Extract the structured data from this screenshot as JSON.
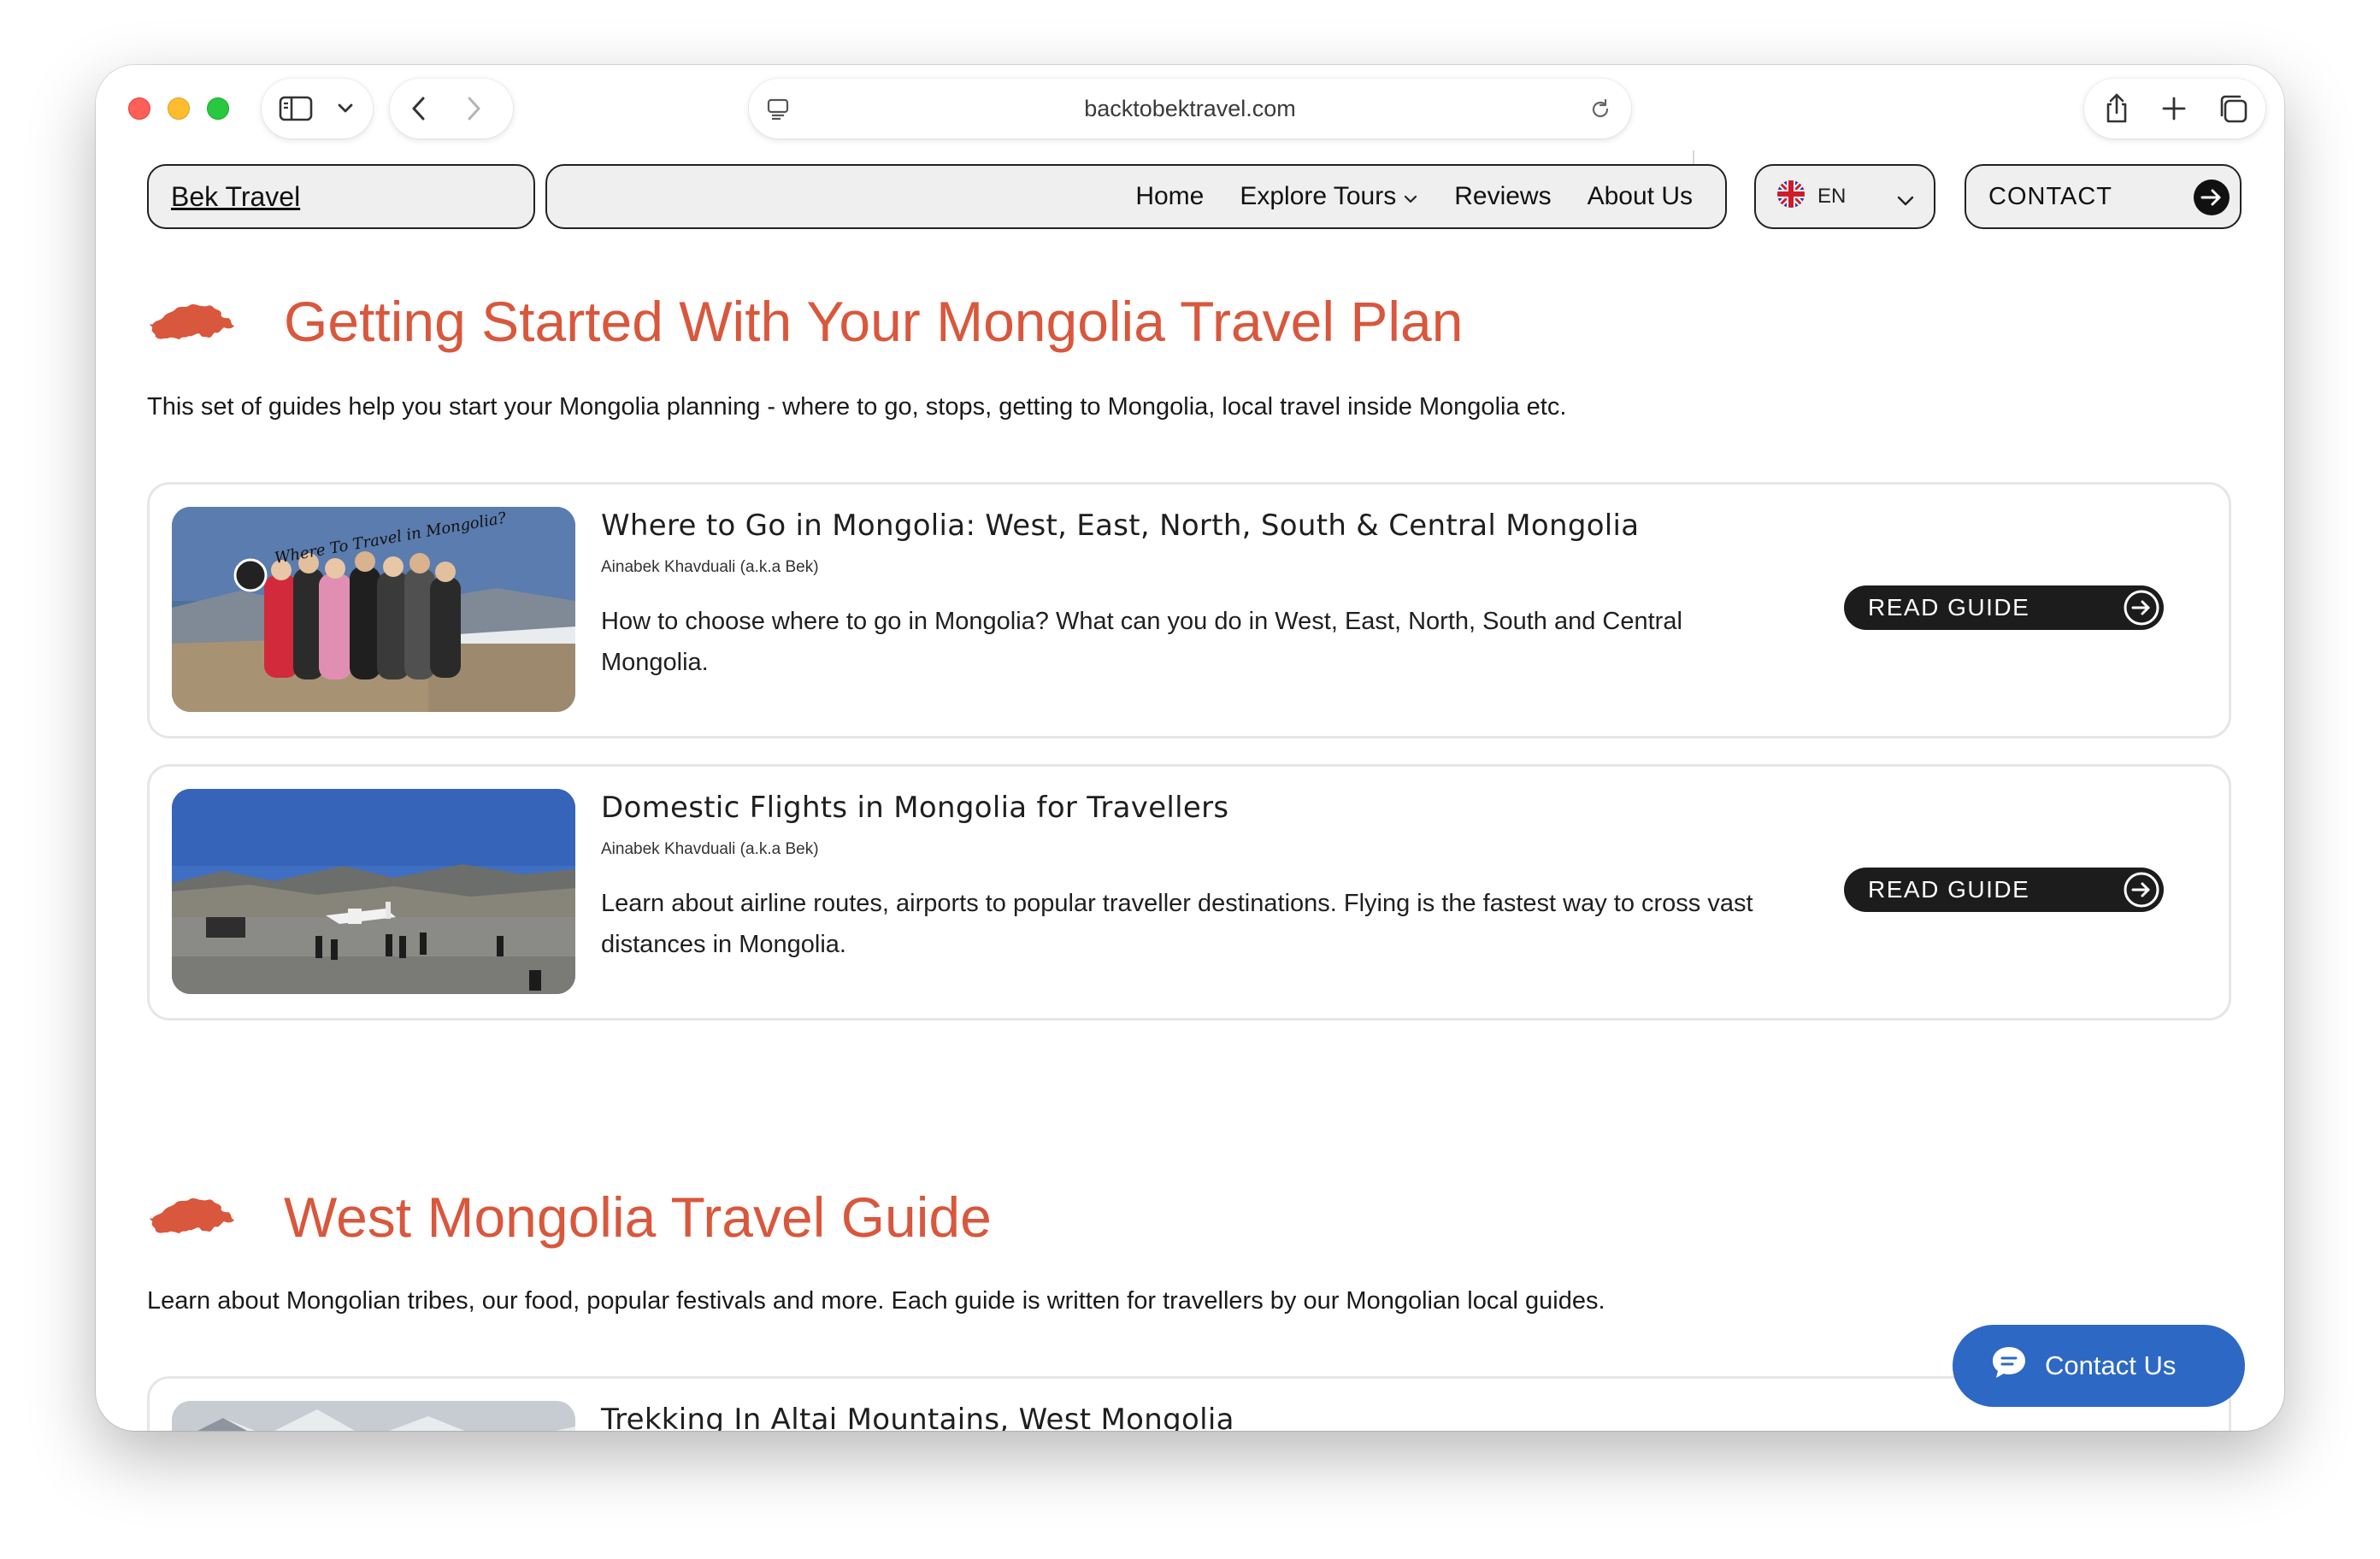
{
  "browser": {
    "url": "backtobektravel.com"
  },
  "header": {
    "logo": "Bek Travel",
    "nav": [
      "Home",
      "Explore Tours",
      "Reviews",
      "About Us"
    ],
    "language": "EN",
    "contact": "CONTACT"
  },
  "sections": [
    {
      "title": "Getting Started With Your Mongolia Travel Plan",
      "description": "This set of guides help you start your Mongolia planning - where to go, stops, getting to Mongolia, local travel inside Mongolia etc.",
      "guides": [
        {
          "title": "Where to Go in Mongolia: West, East, North, South & Central Mongolia",
          "author": "Ainabek Khavduali (a.k.a Bek)",
          "excerpt": "How to choose where to go in Mongolia? What can you do in West, East, North, South and Central Mongolia.",
          "button": "READ GUIDE",
          "image_caption": "Where To Travel in Mongolia?"
        },
        {
          "title": "Domestic Flights in Mongolia for Travellers",
          "author": "Ainabek Khavduali (a.k.a Bek)",
          "excerpt": "Learn about airline routes, airports to popular traveller destinations. Flying is the fastest way to cross vast distances in Mongolia.",
          "button": "READ GUIDE"
        }
      ]
    },
    {
      "title": "West Mongolia Travel Guide",
      "description": "Learn about Mongolian tribes, our food, popular festivals and more. Each guide is written for travellers by our Mongolian local guides.",
      "guides": [
        {
          "title": "Trekking In Altai Mountains, West Mongolia"
        }
      ]
    }
  ],
  "chat": {
    "label": "Contact Us"
  },
  "colors": {
    "accent": "#d9573c",
    "chat": "#2d68c4",
    "button": "#1c1c1c"
  }
}
